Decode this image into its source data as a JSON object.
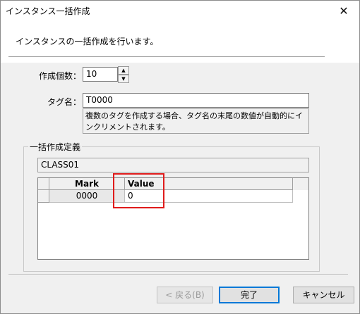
{
  "window": {
    "title": "インスタンス一括作成",
    "close_glyph": "✕"
  },
  "intro": "インスタンスの一括作成を行います。",
  "form": {
    "count_label": "作成個数：",
    "count_value": "10",
    "tag_label": "タグ名：",
    "tag_value": "T0000",
    "hint": "複数のタグを作成する場合、タグ名の末尾の数値が自動的にインクリメントされます。"
  },
  "group": {
    "label": "一括作成定義",
    "class_name": "CLASS01",
    "columns": [
      "Mark",
      "Value"
    ],
    "rows": [
      {
        "mark": "0000",
        "value": "0"
      }
    ]
  },
  "buttons": {
    "back": "< 戻る(B)",
    "finish": "完了",
    "cancel": "キャンセル"
  },
  "colors": {
    "highlight": "#e01b1b",
    "default_button": "#0078d7"
  },
  "icons": {
    "close": "close-icon",
    "spin_up": "up-arrow-icon",
    "spin_down": "down-arrow-icon"
  }
}
